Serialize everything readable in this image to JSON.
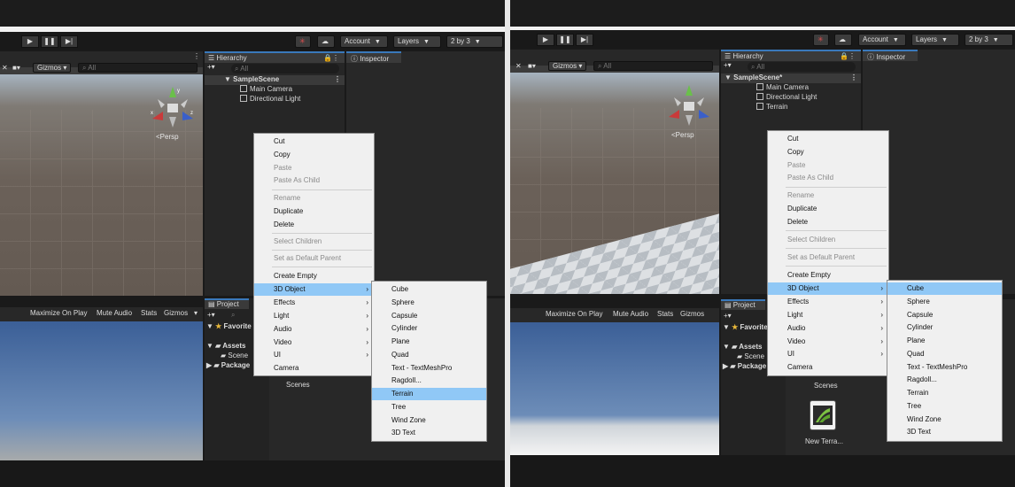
{
  "toolbar": {
    "account": "Account",
    "layers": "Layers",
    "layout": "2 by 3"
  },
  "scene": {
    "gizmos": "Gizmos",
    "search_placeholder": "All",
    "persp": "<Persp",
    "axis_x": "x",
    "axis_y": "y",
    "axis_z": "z"
  },
  "game": {
    "maximize": "Maximize On Play",
    "mute": "Mute Audio",
    "stats": "Stats",
    "gizmos": "Gizmos"
  },
  "hierarchy": {
    "tab": "Hierarchy",
    "search_placeholder": "All",
    "left_scene": "SampleScene",
    "right_scene": "SampleScene*",
    "items": [
      "Main Camera",
      "Directional Light"
    ],
    "right_extra": "Terrain"
  },
  "inspector": {
    "tab": "Inspector"
  },
  "project": {
    "tab": "Project",
    "favorites": "Favorite",
    "assets": "Assets",
    "scenes_child": "Scene",
    "packages": "Package",
    "scenes_folder": "Scenes",
    "new_terrain": "New Terra..."
  },
  "context_menu": {
    "cut": "Cut",
    "copy": "Copy",
    "paste": "Paste",
    "paste_as_child": "Paste As Child",
    "rename": "Rename",
    "duplicate": "Duplicate",
    "delete": "Delete",
    "select_children": "Select Children",
    "set_default_parent": "Set as Default Parent",
    "create_empty": "Create Empty",
    "object3d": "3D Object",
    "effects": "Effects",
    "light": "Light",
    "audio": "Audio",
    "video": "Video",
    "ui": "UI",
    "camera": "Camera"
  },
  "submenu": [
    "Cube",
    "Sphere",
    "Capsule",
    "Cylinder",
    "Plane",
    "Quad",
    "Text - TextMeshPro",
    "Ragdoll...",
    "Terrain",
    "Tree",
    "Wind Zone",
    "3D Text"
  ],
  "highlight": {
    "left": "Terrain",
    "right": "Cube"
  }
}
